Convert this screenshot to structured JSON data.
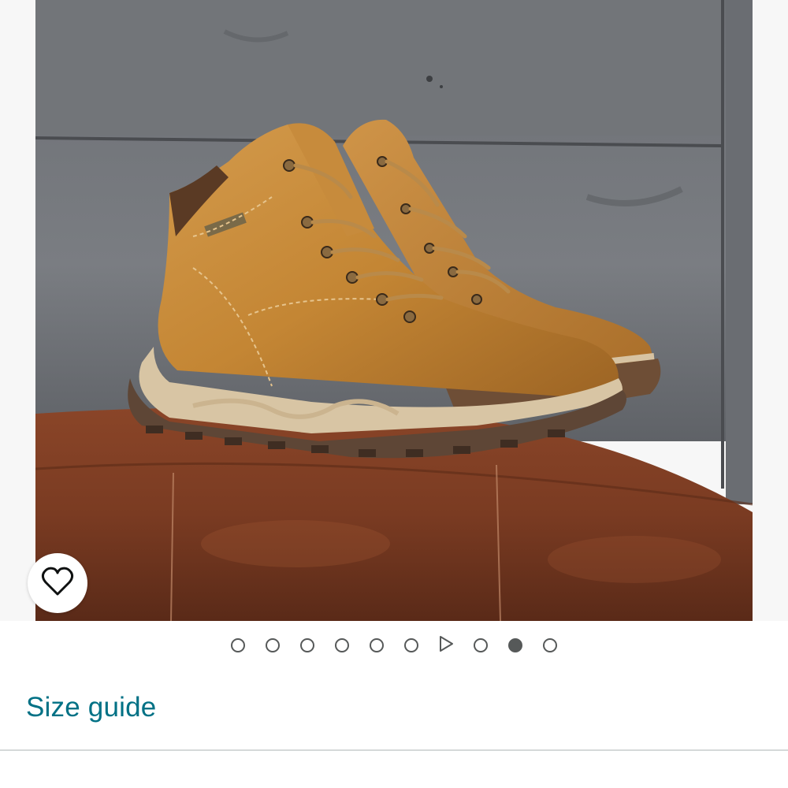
{
  "gallery": {
    "image_count": 10,
    "active_index": 8,
    "video_index": 6,
    "dots": [
      {
        "kind": "image"
      },
      {
        "kind": "image"
      },
      {
        "kind": "image"
      },
      {
        "kind": "image"
      },
      {
        "kind": "image"
      },
      {
        "kind": "image"
      },
      {
        "kind": "video"
      },
      {
        "kind": "image"
      },
      {
        "kind": "image"
      },
      {
        "kind": "image"
      }
    ]
  },
  "wishlist": {
    "icon": "heart-outline-icon"
  },
  "links": {
    "size_guide": "Size guide"
  },
  "colors": {
    "link": "#007185",
    "dot": "#565959",
    "divider": "#d5d9d9"
  }
}
